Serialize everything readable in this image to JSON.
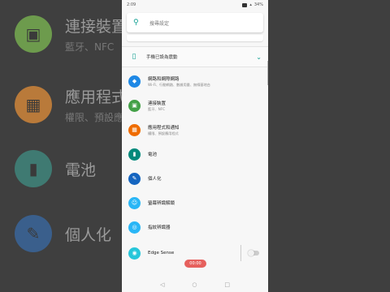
{
  "status_bar": {
    "time": "2:09",
    "battery": "34%"
  },
  "search": {
    "placeholder": "搜尋設定",
    "icon": "search-icon"
  },
  "suggestion": {
    "label": "手機已設為震動",
    "icon": "vibrate-icon"
  },
  "settings": [
    {
      "title": "網路和網際網路",
      "subtitle": "Wi-Fi、行動網路、數據用量、無線基地台",
      "color": "#1e88e5",
      "icon": "wifi-icon"
    },
    {
      "title": "連接裝置",
      "subtitle": "藍牙、NFC",
      "color": "#43a047",
      "icon": "devices-icon"
    },
    {
      "title": "應用程式和通知",
      "subtitle": "權限、預設應用程式",
      "color": "#ef6c00",
      "icon": "apps-icon"
    },
    {
      "title": "電池",
      "subtitle": "",
      "color": "#00897b",
      "icon": "battery-icon"
    },
    {
      "title": "個人化",
      "subtitle": "",
      "color": "#1565c0",
      "icon": "personalize-icon"
    },
    {
      "title": "螢幕辨識解鎖",
      "subtitle": "",
      "color": "#29b6f6",
      "icon": "face-unlock-icon"
    },
    {
      "title": "指紋辨識器",
      "subtitle": "",
      "color": "#29b6f6",
      "icon": "fingerprint-icon"
    },
    {
      "title": "Edge Sense",
      "subtitle": "",
      "color": "#26c6da",
      "icon": "edge-sense-icon"
    }
  ],
  "recording": {
    "label": "00:00"
  },
  "background": [
    {
      "title": "連接裝置",
      "subtitle": "藍牙、NFC",
      "color": "#6d9b4d"
    },
    {
      "title": "應用程式和通",
      "subtitle": "權限、預設應用",
      "color": "#b97a3a"
    },
    {
      "title": "電池",
      "subtitle": "",
      "color": "#3f7a72"
    },
    {
      "title": "個人化",
      "subtitle": "",
      "color": "#3a5f8c"
    }
  ]
}
